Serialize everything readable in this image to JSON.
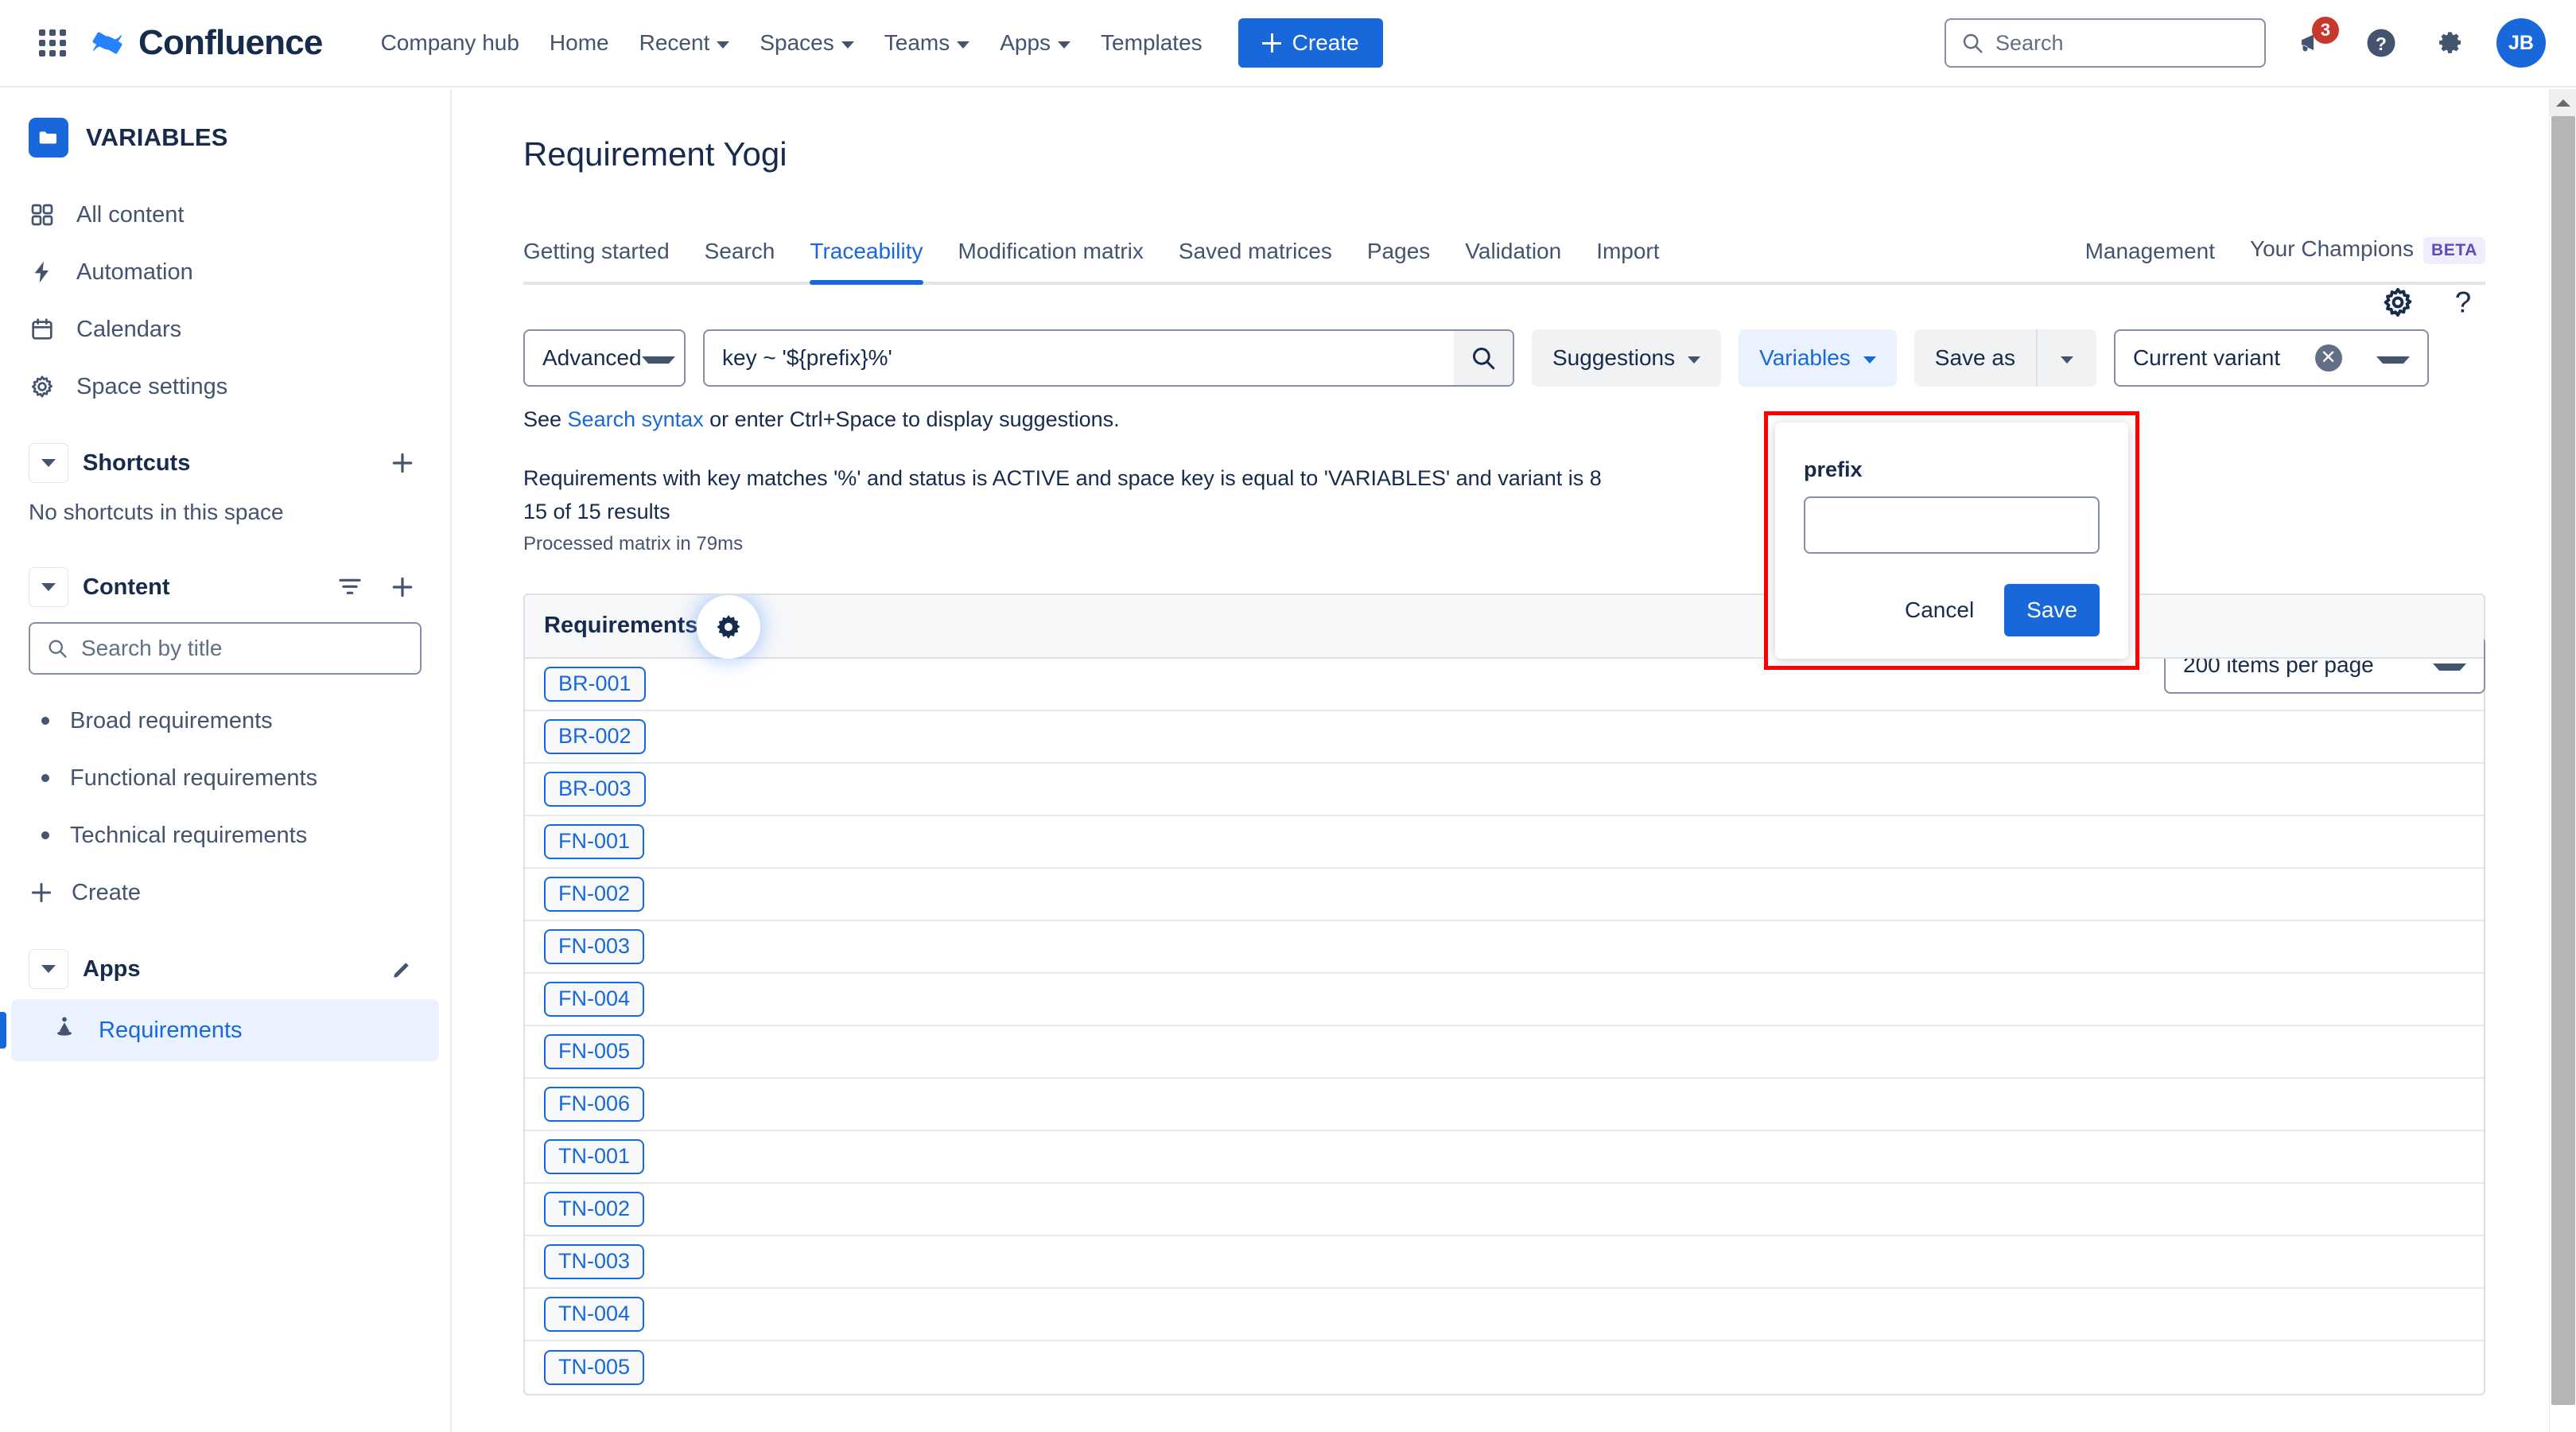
{
  "topnav": {
    "app_switcher_icon": "grid-apps-icon",
    "brand": "Confluence",
    "links": [
      {
        "label": "Company hub",
        "has_caret": false
      },
      {
        "label": "Home",
        "has_caret": false
      },
      {
        "label": "Recent",
        "has_caret": true
      },
      {
        "label": "Spaces",
        "has_caret": true
      },
      {
        "label": "Teams",
        "has_caret": true
      },
      {
        "label": "Apps",
        "has_caret": true
      },
      {
        "label": "Templates",
        "has_caret": false
      }
    ],
    "create_label": "Create",
    "search_placeholder": "Search",
    "notifications_count": "3",
    "help_icon": "question-circle-icon",
    "settings_icon": "gear-icon",
    "avatar_initials": "JB"
  },
  "sidebar": {
    "space_name": "VARIABLES",
    "nav": [
      {
        "label": "All content",
        "icon": "grid-squares-icon"
      },
      {
        "label": "Automation",
        "icon": "lightning-bolt-icon"
      },
      {
        "label": "Calendars",
        "icon": "calendar-icon"
      },
      {
        "label": "Space settings",
        "icon": "gear-icon"
      }
    ],
    "shortcuts": {
      "title": "Shortcuts",
      "empty_text": "No shortcuts in this space"
    },
    "content": {
      "title": "Content",
      "search_placeholder": "Search by title",
      "pages": [
        "Broad requirements",
        "Functional requirements",
        "Technical requirements"
      ],
      "create_label": "Create"
    },
    "apps": {
      "title": "Apps",
      "items": [
        "Requirements"
      ]
    }
  },
  "main": {
    "page_title": "Requirement Yogi",
    "header_icons": [
      "gear-icon",
      "question-mark-icon"
    ],
    "tabs": [
      {
        "label": "Getting started",
        "active": false
      },
      {
        "label": "Search",
        "active": false
      },
      {
        "label": "Traceability",
        "active": true
      },
      {
        "label": "Modification matrix",
        "active": false
      },
      {
        "label": "Saved matrices",
        "active": false
      },
      {
        "label": "Pages",
        "active": false
      },
      {
        "label": "Validation",
        "active": false
      },
      {
        "label": "Import",
        "active": false
      }
    ],
    "right_tabs": [
      {
        "label": "Management",
        "badge": ""
      },
      {
        "label": "Your Champions",
        "badge": "BETA"
      }
    ],
    "toolbar": {
      "mode_select_value": "Advanced",
      "query_value": "key ~ '${prefix}%'",
      "query_placeholder": "",
      "search_icon": "magnifying-glass-icon",
      "suggestions_label": "Suggestions",
      "variables_label": "Variables",
      "save_as_label": "Save as",
      "variant_value": "Current variant"
    },
    "hint_prefix": "See ",
    "hint_link": "Search syntax",
    "hint_suffix": " or enter Ctrl+Space to display suggestions.",
    "summary_line1": "Requirements with key matches '%' and status is ACTIVE and space key is equal to 'VARIABLES' and variant is 8",
    "summary_line2": "15 of 15 results",
    "summary_line3": "Processed matrix in 79ms",
    "per_page_value": "200 items per page",
    "table": {
      "header": "Requirements",
      "header_gear_icon": "gear-icon",
      "rows": [
        "BR-001",
        "BR-002",
        "BR-003",
        "FN-001",
        "FN-002",
        "FN-003",
        "FN-004",
        "FN-005",
        "FN-006",
        "TN-001",
        "TN-002",
        "TN-003",
        "TN-004",
        "TN-005"
      ]
    }
  },
  "variables_popup": {
    "field_label": "prefix",
    "field_value": "",
    "field_placeholder": "",
    "cancel_label": "Cancel",
    "save_label": "Save"
  },
  "colors": {
    "brand_blue": "#1868DB",
    "accent_red": "#FF0000",
    "badge_red": "#C9372C",
    "beta_purple": "#5E4DB2",
    "text": "#172B4D",
    "subtle_text": "#44546F"
  }
}
